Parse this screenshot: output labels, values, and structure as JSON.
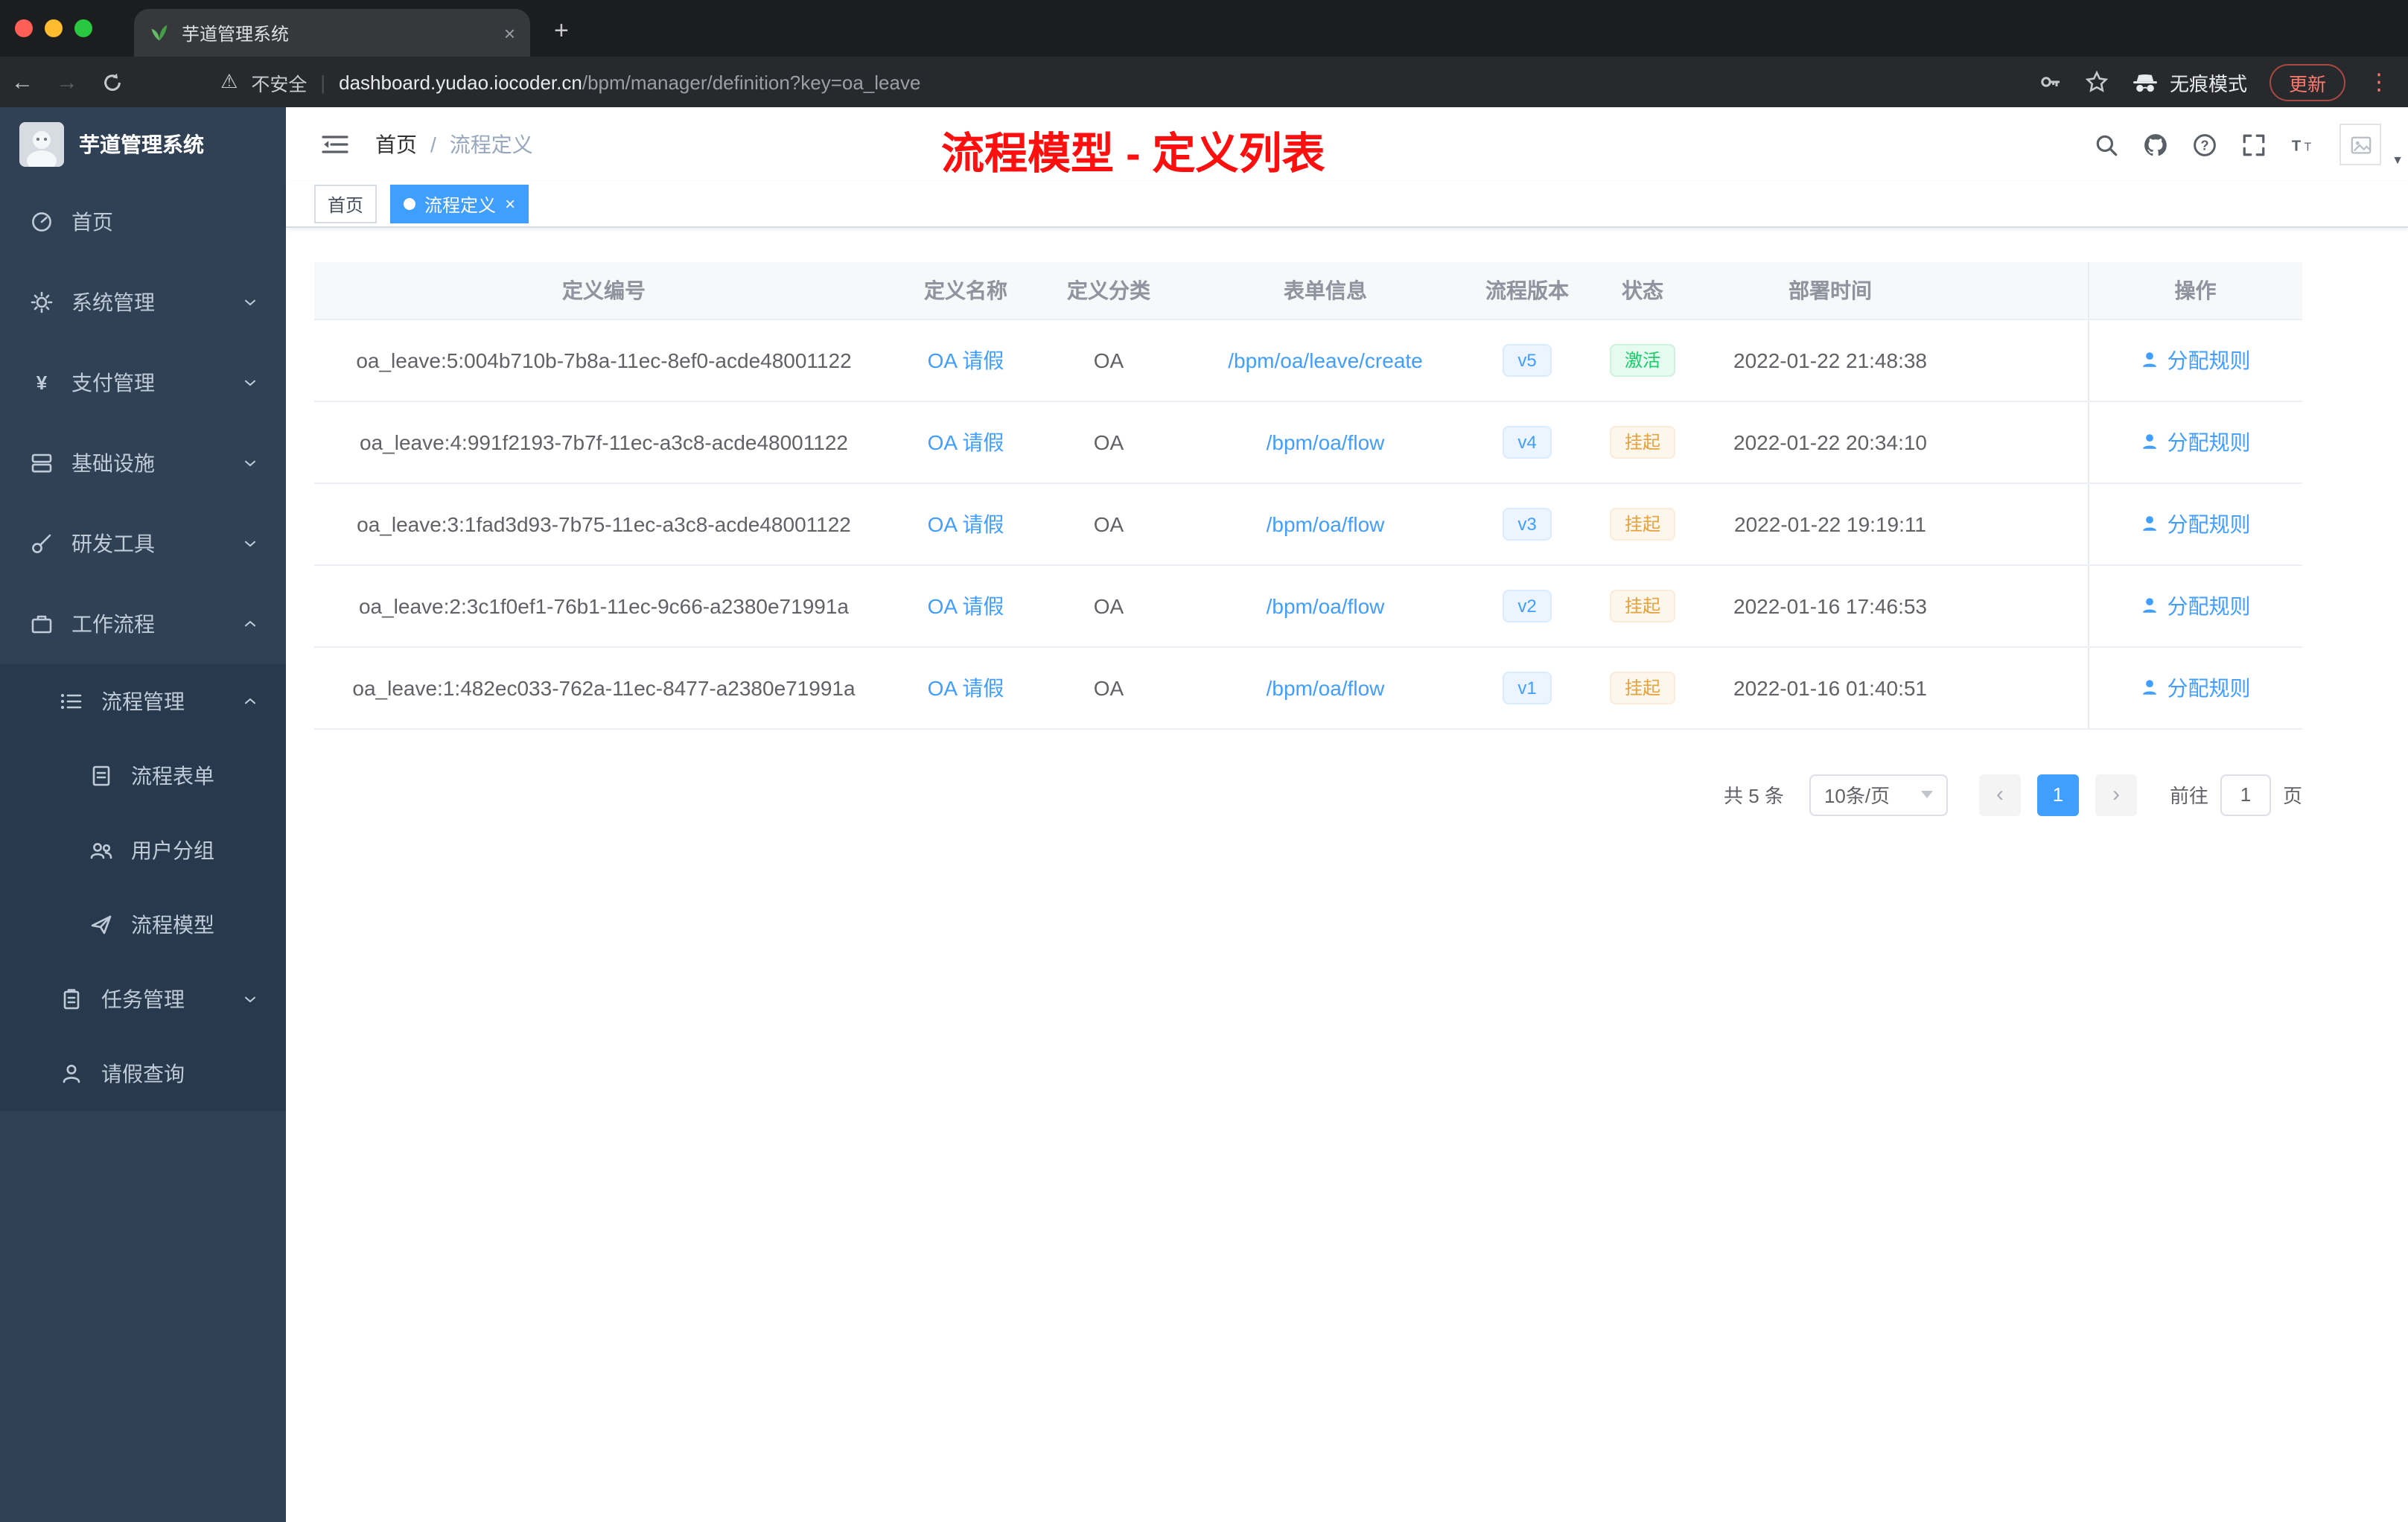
{
  "browser": {
    "tab_title": "芋道管理系统",
    "security_label": "不安全",
    "url_host": "dashboard.yudao.iocoder.cn",
    "url_path": "/bpm/manager/definition?key=oa_leave",
    "incognito_label": "无痕模式",
    "update_label": "更新"
  },
  "icons": {
    "close": "×",
    "new_tab": "+",
    "back": "←",
    "forward": "→",
    "warning": "⚠",
    "divider": "|",
    "kebab": "⋮",
    "prev": "‹",
    "next": "›",
    "caret_down": "▼"
  },
  "sidebar": {
    "title": "芋道管理系统",
    "items": [
      {
        "label": "首页",
        "icon": "dashboard-icon"
      },
      {
        "label": "系统管理",
        "icon": "gear-icon",
        "expand": "down"
      },
      {
        "label": "支付管理",
        "icon": "yen-icon",
        "expand": "down"
      },
      {
        "label": "基础设施",
        "icon": "server-icon",
        "expand": "down"
      },
      {
        "label": "研发工具",
        "icon": "wrench-icon",
        "expand": "down"
      },
      {
        "label": "工作流程",
        "icon": "briefcase-icon",
        "expand": "up"
      },
      {
        "label": "流程管理",
        "icon": "list-icon",
        "expand": "up"
      },
      {
        "label": "流程表单",
        "icon": "form-icon"
      },
      {
        "label": "用户分组",
        "icon": "users-icon"
      },
      {
        "label": "流程模型",
        "icon": "send-icon"
      },
      {
        "label": "任务管理",
        "icon": "clipboard-icon",
        "expand": "down"
      },
      {
        "label": "请假查询",
        "icon": "user-icon"
      }
    ]
  },
  "header": {
    "breadcrumb": {
      "home": "首页",
      "separator": "/",
      "current": "流程定义"
    },
    "annotation": "流程模型 - 定义列表"
  },
  "tags": [
    {
      "label": "首页",
      "active": false
    },
    {
      "label": "流程定义",
      "active": true
    }
  ],
  "table": {
    "columns": [
      "定义编号",
      "定义名称",
      "定义分类",
      "表单信息",
      "流程版本",
      "状态",
      "部署时间",
      "操作"
    ],
    "rows": [
      {
        "id": "oa_leave:5:004b710b-7b8a-11ec-8ef0-acde48001122",
        "name": "OA 请假",
        "category": "OA",
        "form": "/bpm/oa/leave/create",
        "version": "v5",
        "status": "激活",
        "deployed": "2022-01-22 21:48:38",
        "action": "分配规则"
      },
      {
        "id": "oa_leave:4:991f2193-7b7f-11ec-a3c8-acde48001122",
        "name": "OA 请假",
        "category": "OA",
        "form": "/bpm/oa/flow",
        "version": "v4",
        "status": "挂起",
        "deployed": "2022-01-22 20:34:10",
        "action": "分配规则"
      },
      {
        "id": "oa_leave:3:1fad3d93-7b75-11ec-a3c8-acde48001122",
        "name": "OA 请假",
        "category": "OA",
        "form": "/bpm/oa/flow",
        "version": "v3",
        "status": "挂起",
        "deployed": "2022-01-22 19:19:11",
        "action": "分配规则"
      },
      {
        "id": "oa_leave:2:3c1f0ef1-76b1-11ec-9c66-a2380e71991a",
        "name": "OA 请假",
        "category": "OA",
        "form": "/bpm/oa/flow",
        "version": "v2",
        "status": "挂起",
        "deployed": "2022-01-16 17:46:53",
        "action": "分配规则"
      },
      {
        "id": "oa_leave:1:482ec033-762a-11ec-8477-a2380e71991a",
        "name": "OA 请假",
        "category": "OA",
        "form": "/bpm/oa/flow",
        "version": "v1",
        "status": "挂起",
        "deployed": "2022-01-16 01:40:51",
        "action": "分配规则"
      }
    ]
  },
  "pagination": {
    "total": "共 5 条",
    "page_size": "10条/页",
    "page": "1",
    "goto_label": "前往",
    "goto_value": "1",
    "page_unit": "页"
  },
  "colors": {
    "accent": "#409eff",
    "success": "#13ce66",
    "warning": "#e6a23c",
    "annotation_red": "#fb0f0f",
    "sidebar_bg": "#304156"
  }
}
